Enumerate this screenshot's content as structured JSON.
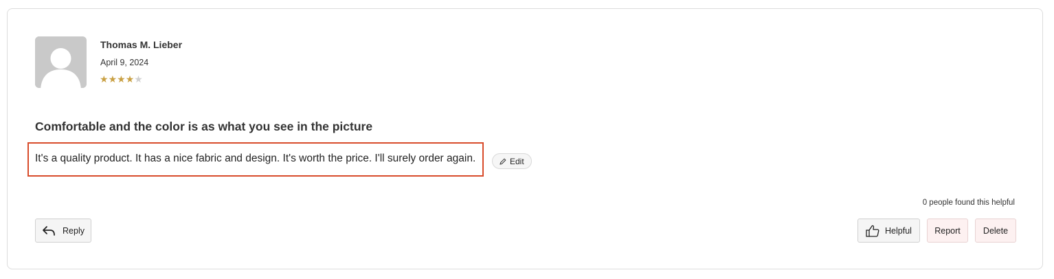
{
  "review": {
    "author": "Thomas M. Lieber",
    "date": "April 9, 2024",
    "rating": 4,
    "rating_max": 5,
    "title": "Comfortable and the color is as what you see in the picture",
    "body": "It's a quality product. It has a nice fabric and design. It's worth the price. I'll surely order again.",
    "highlight_color": "#d84b2a",
    "star_color": "#c9a043"
  },
  "actions": {
    "edit_label": "Edit",
    "helpful_count_text": "0 people found this helpful",
    "reply_label": "Reply",
    "helpful_label": "Helpful",
    "report_label": "Report",
    "delete_label": "Delete"
  },
  "icons": {
    "avatar": "user-placeholder-icon",
    "edit": "pencil-icon",
    "reply": "reply-arrow-icon",
    "helpful": "thumbs-up-icon"
  }
}
